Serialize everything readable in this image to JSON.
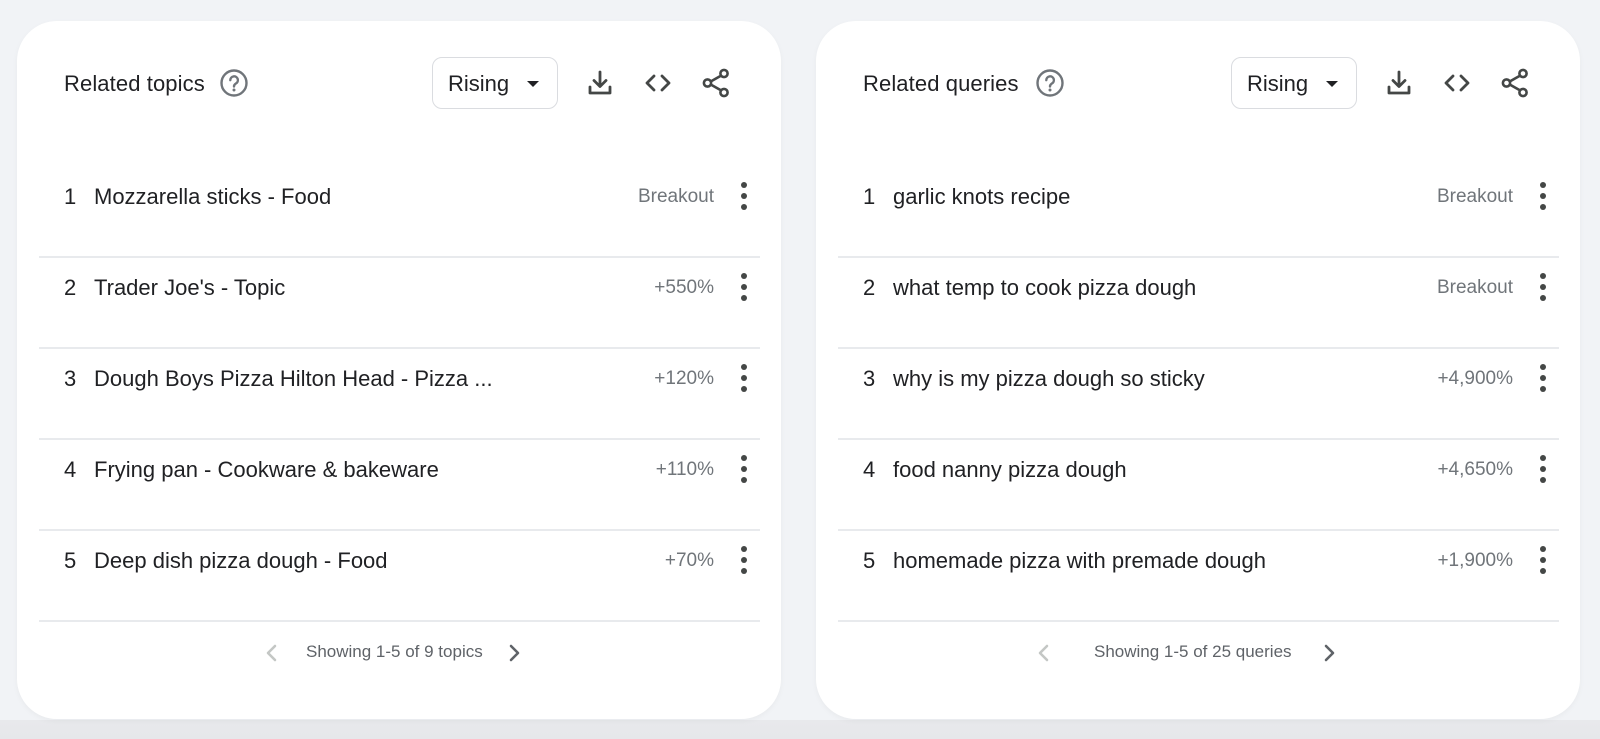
{
  "panels": {
    "topics": {
      "title": "Related topics",
      "filter": "Rising",
      "items": [
        {
          "rank": "1",
          "label": "Mozzarella sticks - Food",
          "value": "Breakout"
        },
        {
          "rank": "2",
          "label": "Trader Joe's - Topic",
          "value": "+550%"
        },
        {
          "rank": "3",
          "label": "Dough Boys Pizza Hilton Head - Pizza ...",
          "value": "+120%"
        },
        {
          "rank": "4",
          "label": "Frying pan - Cookware & bakeware",
          "value": "+110%"
        },
        {
          "rank": "5",
          "label": "Deep dish pizza dough - Food",
          "value": "+70%"
        }
      ],
      "pager_text": "Showing 1-5 of 9 topics"
    },
    "queries": {
      "title": "Related queries",
      "filter": "Rising",
      "items": [
        {
          "rank": "1",
          "label": "garlic knots recipe",
          "value": "Breakout"
        },
        {
          "rank": "2",
          "label": "what temp to cook pizza dough",
          "value": "Breakout"
        },
        {
          "rank": "3",
          "label": "why is my pizza dough so sticky",
          "value": "+4,900%"
        },
        {
          "rank": "4",
          "label": "food nanny pizza dough",
          "value": "+4,650%"
        },
        {
          "rank": "5",
          "label": "homemade pizza with premade dough",
          "value": "+1,900%"
        }
      ],
      "pager_text": "Showing 1-5 of 25 queries"
    }
  },
  "icons": {
    "help": "help-circle-icon",
    "caret": "arrow-drop-down-icon",
    "download": "download-icon",
    "embed": "code-icon",
    "share": "share-icon",
    "more": "more-vert-icon",
    "prev": "chevron-left-icon",
    "next": "chevron-right-icon"
  },
  "colors": {
    "background": "#f1f3f6",
    "card": "#ffffff",
    "text_primary": "#202124",
    "text_secondary": "#70757a",
    "divider": "#e8eaed",
    "icon": "#444746",
    "icon_disabled": "#c4c7c5"
  }
}
